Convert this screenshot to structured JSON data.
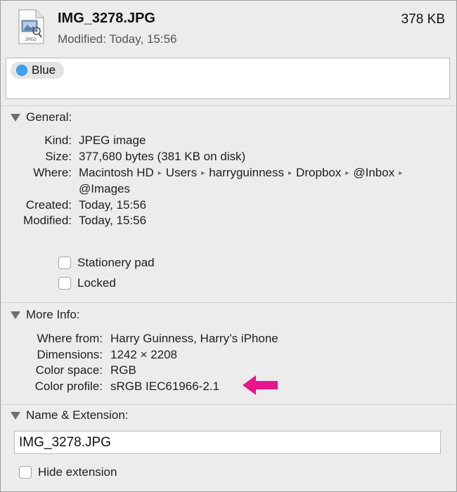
{
  "header": {
    "file_name": "IMG_3278.JPG",
    "file_size": "378 KB",
    "modified": "Modified: Today, 15:56",
    "icon_label": "JPEG"
  },
  "tags": [
    {
      "label": "Blue",
      "color": "#3fa1f6"
    }
  ],
  "general": {
    "title": "General:",
    "kind_label": "Kind:",
    "kind_value": "JPEG image",
    "size_label": "Size:",
    "size_value": "377,680 bytes (381 KB on disk)",
    "where_label": "Where:",
    "where_path": [
      "Macintosh HD",
      "Users",
      "harryguinness",
      "Dropbox",
      "@Inbox",
      "@Images"
    ],
    "created_label": "Created:",
    "created_value": "Today, 15:56",
    "modified_label": "Modified:",
    "modified_value": "Today, 15:56",
    "stationery_label": "Stationery pad",
    "locked_label": "Locked"
  },
  "more_info": {
    "title": "More Info:",
    "where_from_label": "Where from:",
    "where_from_value": "Harry Guinness, Harry’s iPhone",
    "dimensions_label": "Dimensions:",
    "dimensions_value": "1242 × 2208",
    "color_space_label": "Color space:",
    "color_space_value": "RGB",
    "color_profile_label": "Color profile:",
    "color_profile_value": "sRGB IEC61966-2.1"
  },
  "name_extension": {
    "title": "Name & Extension:",
    "name_value": "IMG_3278.JPG",
    "hide_extension_label": "Hide extension"
  },
  "colors": {
    "annotation_arrow": "#e8158c",
    "tag_blue": "#3fa1f6"
  }
}
